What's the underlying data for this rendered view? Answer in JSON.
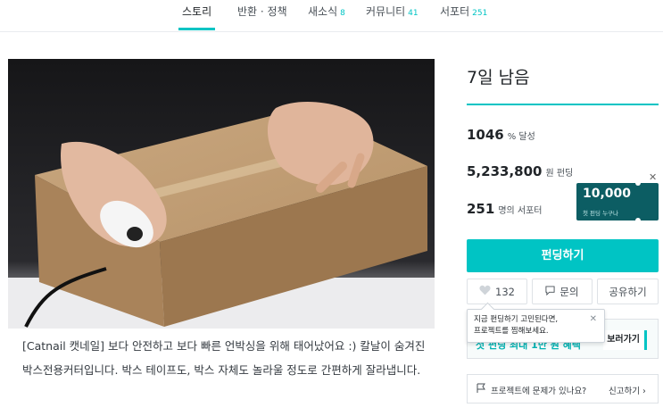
{
  "nav": {
    "tabs": [
      {
        "label": "스토리",
        "count": ""
      },
      {
        "label": "반환 · 정책",
        "count": ""
      },
      {
        "label": "새소식",
        "count": "8"
      },
      {
        "label": "커뮤니티",
        "count": "41"
      },
      {
        "label": "서포터",
        "count": "251"
      }
    ],
    "active_tab": 0,
    "accent_color": "#00c4c4"
  },
  "hero_image": {
    "icon": "product-photo"
  },
  "story": {
    "text": "[Catnail 캣네일] 보다 안전하고 보다 빠른 언박싱을 위해 태어났어요 :) 칼날이 숨겨진 박스전용커터입니다. 박스 테이프도, 박스 자체도 놀라울 정도로 간편하게 잘라냅니다."
  },
  "campaign": {
    "days_left": "7일 남음",
    "percent": {
      "value": "1046",
      "unit": "% 달성"
    },
    "amount": {
      "value": "5,233,800",
      "unit": "원 펀딩"
    },
    "supporters": {
      "value": "251",
      "unit": "명의 서포터"
    }
  },
  "coupon": {
    "amount": "10,000",
    "subtitle": "첫 펀딩 누구나",
    "close_icon": "close-icon"
  },
  "actions": {
    "fund_label": "펀딩하기",
    "like_count": "132",
    "inquiry_label": "문의",
    "share_label": "공유하기"
  },
  "tooltip": {
    "line1": "지금 펀딩하기 고민된다면,",
    "line2": "프로젝트를 찜해보세요."
  },
  "promo": {
    "text": "첫 펀딩 최대 1만 원 혜택",
    "button": "보러가기"
  },
  "report": {
    "question": "프로젝트에 문제가 있나요?",
    "action": "신고하기 ›"
  }
}
